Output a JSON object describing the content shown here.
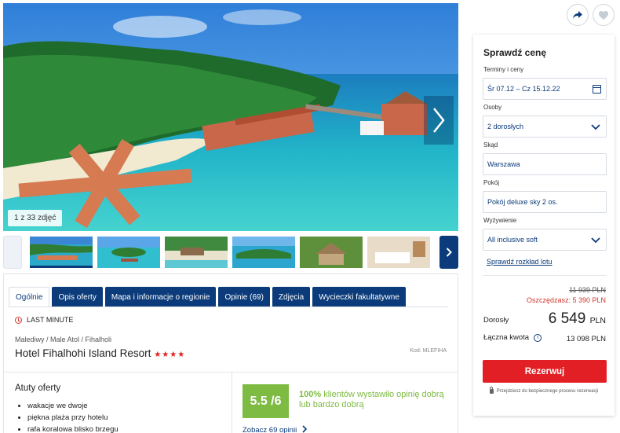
{
  "gallery": {
    "photo_count": "1 z 33 zdjęć"
  },
  "tabs": [
    {
      "label": "Ogólnie"
    },
    {
      "label": "Opis oferty"
    },
    {
      "label": "Mapa i informacje o regionie"
    },
    {
      "label": "Opinie (69)"
    },
    {
      "label": "Zdjęcia"
    },
    {
      "label": "Wycieczki fakultatywne"
    }
  ],
  "hotel": {
    "badge": "LAST MINUTE",
    "breadcrumb": "Malediwy / Male Atol / Fihalholi",
    "name": "Hotel Fihalhohi Island Resort",
    "stars": "★★★★",
    "code": "Kod: MLEFIHA"
  },
  "highlights": {
    "title": "Atuty oferty",
    "items": [
      "wakacje we dwoje",
      "piękna plaża przy hotelu",
      "rafa koralowa blisko brzegu"
    ]
  },
  "rating": {
    "score": "5.5 /6",
    "percent": "100%",
    "text": " klientów wystawiło opinię dobrą lub bardzo dobrą",
    "link": "Zobacz 69 opinii"
  },
  "price_card": {
    "title": "Sprawdź cenę",
    "dates_label": "Terminy i ceny",
    "dates_value": "Śr 07.12 – Cz 15.12.22",
    "persons_label": "Osoby",
    "persons_value": "2 dorosłych",
    "from_label": "Skąd",
    "from_value": "Warszawa",
    "room_label": "Pokój",
    "room_value": "Pokój deluxe sky 2 os.",
    "board_label": "Wyżywienie",
    "board_value": "All inclusive soft",
    "schedule_link": "Sprawdź rozkład lotu",
    "old_price": "11 939  PLN",
    "saving": "Oszczędzasz: 5 390 PLN",
    "adult_label": "Dorosły",
    "adult_price": "6 549",
    "adult_currency": "PLN",
    "total_label": "Łączna kwota",
    "total_value": "13 098 PLN",
    "reserve_button": "Rezerwuj",
    "secure_note": "Przejdziesz do bezpiecznego procesu rezerwacji"
  },
  "colors": {
    "brand": "#0b3b7a",
    "reserve": "#e31f26",
    "rating": "#7dbb42"
  }
}
